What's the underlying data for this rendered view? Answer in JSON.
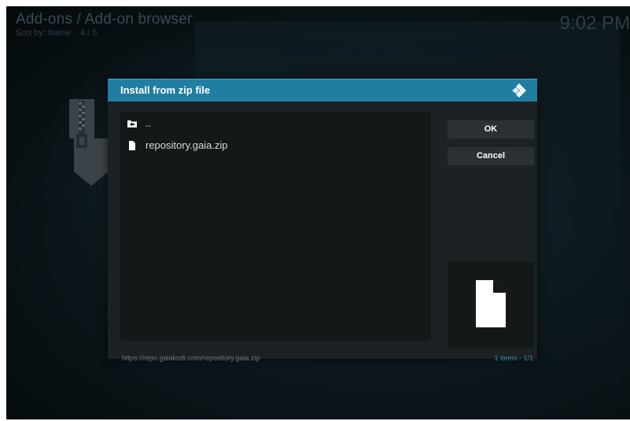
{
  "header": {
    "title": "Add-ons / Add-on browser",
    "sort_label": "Sort by: Name",
    "position": "4 / 5"
  },
  "clock": "9:02 PM",
  "dialog": {
    "title": "Install from zip file",
    "list": [
      {
        "label": "..",
        "icon": "folder-up-icon"
      },
      {
        "label": "repository.gaia.zip",
        "icon": "file-icon"
      }
    ],
    "buttons": {
      "ok_label": "OK",
      "cancel_label": "Cancel"
    },
    "status": {
      "path": "https://repo.gaiakodi.com/repository.gaia.zip",
      "count": "1 items - 1/1"
    }
  },
  "colors": {
    "header_bar": "#1f7ea1",
    "dialog_bg": "#1c2124",
    "list_bg": "#141819",
    "accent_text": "#2a8fb8"
  }
}
